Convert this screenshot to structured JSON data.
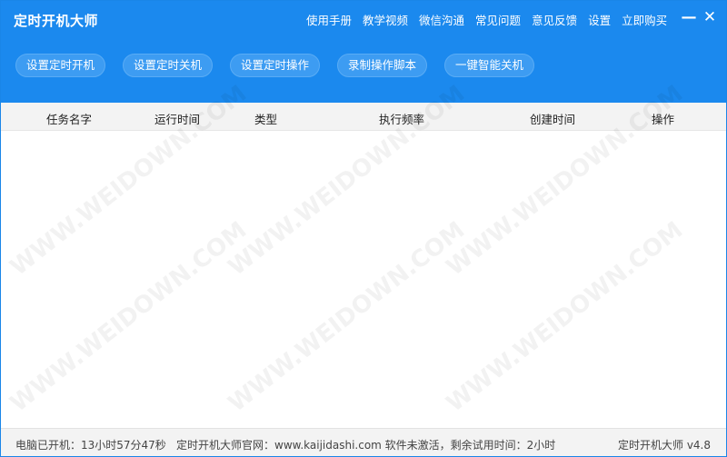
{
  "app": {
    "title": "定时开机大师"
  },
  "top_menu": {
    "items": [
      "使用手册",
      "教学视频",
      "微信沟通",
      "常见问题",
      "意见反馈",
      "设置",
      "立即购买"
    ]
  },
  "window_controls": {
    "minimize": "—",
    "close": "✕"
  },
  "toolbar": {
    "buttons": [
      "设置定时开机",
      "设置定时关机",
      "设置定时操作",
      "录制操作脚本",
      "一键智能关机"
    ]
  },
  "table": {
    "columns": [
      "任务名字",
      "运行时间",
      "类型",
      "执行频率",
      "创建时间",
      "操作"
    ],
    "rows": []
  },
  "watermark": {
    "text": "WWW.WEIDOWN.COM"
  },
  "statusbar": {
    "uptime": "电脑已开机：13小时57分47秒",
    "site": "定时开机大师官网：www.kaijidashi.com 软件未激活，剩余试用时间：2小时",
    "version": "定时开机大师 v4.8"
  },
  "colors": {
    "header_bg": "#1b89ee",
    "button_bg": "#3d9cf2",
    "table_head_bg": "#f3f3f3",
    "statusbar_bg": "#f3f3f3"
  }
}
